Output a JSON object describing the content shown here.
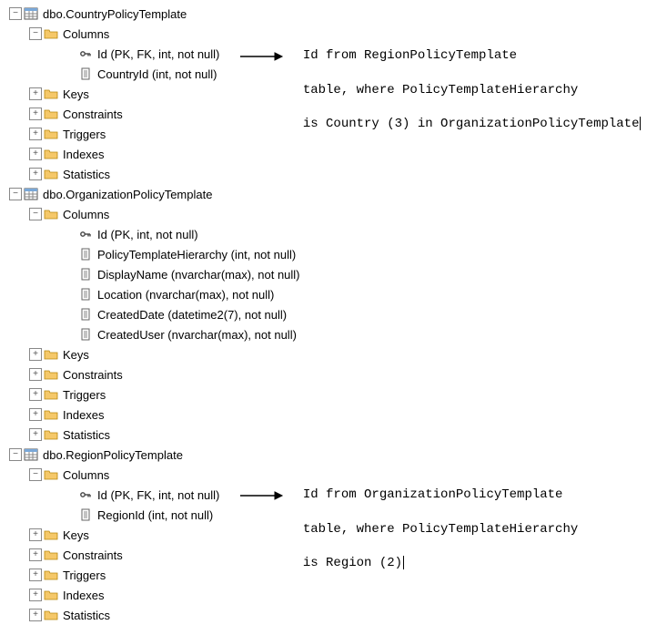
{
  "tree": {
    "tables": [
      {
        "name": "dbo.CountryPolicyTemplate",
        "expanded": true,
        "children": [
          {
            "name": "Columns",
            "type": "folder",
            "expanded": true,
            "children": [
              {
                "name": "Id (PK, FK, int, not null)",
                "type": "key"
              },
              {
                "name": "CountryId (int, not null)",
                "type": "col"
              }
            ]
          },
          {
            "name": "Keys",
            "type": "folder",
            "expanded": false
          },
          {
            "name": "Constraints",
            "type": "folder",
            "expanded": false
          },
          {
            "name": "Triggers",
            "type": "folder",
            "expanded": false
          },
          {
            "name": "Indexes",
            "type": "folder",
            "expanded": false
          },
          {
            "name": "Statistics",
            "type": "folder",
            "expanded": false
          }
        ]
      },
      {
        "name": "dbo.OrganizationPolicyTemplate",
        "expanded": true,
        "children": [
          {
            "name": "Columns",
            "type": "folder",
            "expanded": true,
            "children": [
              {
                "name": "Id (PK, int, not null)",
                "type": "key"
              },
              {
                "name": "PolicyTemplateHierarchy (int, not null)",
                "type": "col"
              },
              {
                "name": "DisplayName (nvarchar(max), not null)",
                "type": "col"
              },
              {
                "name": "Location (nvarchar(max), not null)",
                "type": "col"
              },
              {
                "name": "CreatedDate (datetime2(7), not null)",
                "type": "col"
              },
              {
                "name": "CreatedUser (nvarchar(max), not null)",
                "type": "col"
              }
            ]
          },
          {
            "name": "Keys",
            "type": "folder",
            "expanded": false
          },
          {
            "name": "Constraints",
            "type": "folder",
            "expanded": false
          },
          {
            "name": "Triggers",
            "type": "folder",
            "expanded": false
          },
          {
            "name": "Indexes",
            "type": "folder",
            "expanded": false
          },
          {
            "name": "Statistics",
            "type": "folder",
            "expanded": false
          }
        ]
      },
      {
        "name": "dbo.RegionPolicyTemplate",
        "expanded": true,
        "children": [
          {
            "name": "Columns",
            "type": "folder",
            "expanded": true,
            "children": [
              {
                "name": "Id (PK, FK, int, not null)",
                "type": "key"
              },
              {
                "name": "RegionId (int, not null)",
                "type": "col"
              }
            ]
          },
          {
            "name": "Keys",
            "type": "folder",
            "expanded": false
          },
          {
            "name": "Constraints",
            "type": "folder",
            "expanded": false
          },
          {
            "name": "Triggers",
            "type": "folder",
            "expanded": false
          },
          {
            "name": "Indexes",
            "type": "folder",
            "expanded": false
          },
          {
            "name": "Statistics",
            "type": "folder",
            "expanded": false
          }
        ]
      }
    ]
  },
  "annotations": {
    "a1_line1": "Id from RegionPolicyTemplate",
    "a1_line2": "table, where PolicyTemplateHierarchy",
    "a1_line3": "is Country (3) in OrganizationPolicyTemplate",
    "a2_line1": "Id from OrganizationPolicyTemplate",
    "a2_line2": "table, where PolicyTemplateHierarchy",
    "a2_line3": "is Region (2)"
  },
  "glyphs": {
    "plus": "+",
    "minus": "−"
  }
}
